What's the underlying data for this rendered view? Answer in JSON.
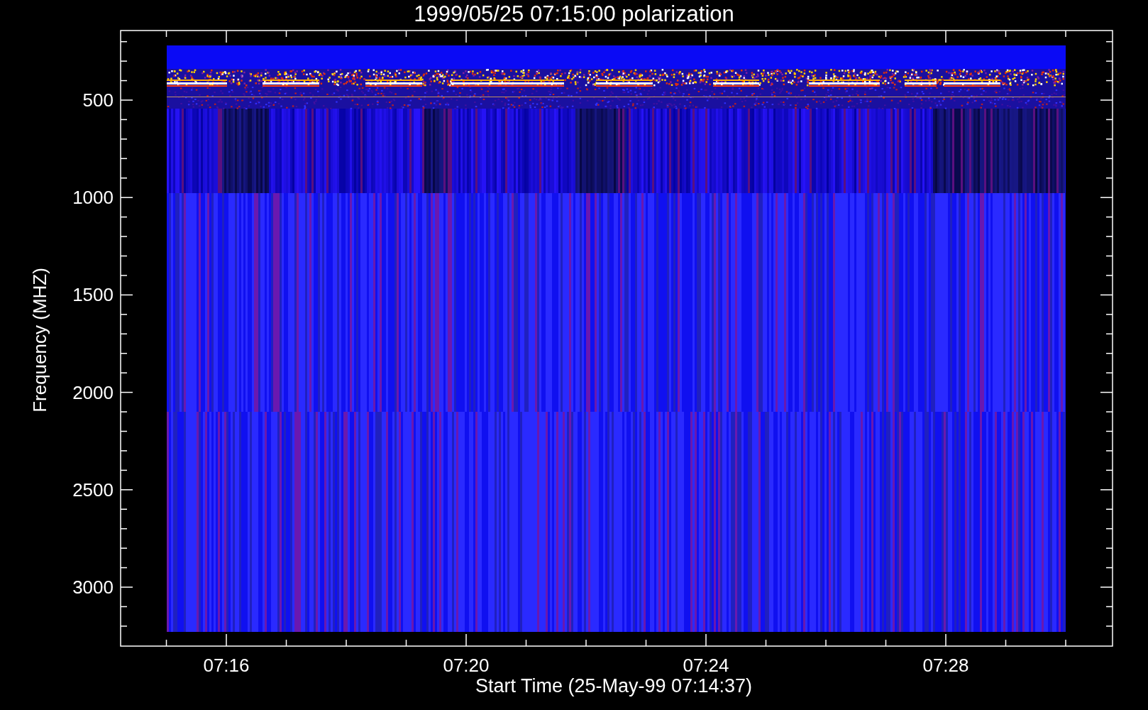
{
  "title": "1999/05/25 07:15:00 polarization",
  "y_axis": {
    "label": "Frequency (MHZ)",
    "ticks": [
      "500",
      "1000",
      "1500",
      "2000",
      "2500",
      "3000"
    ]
  },
  "x_axis": {
    "label": "Start Time (25-May-99 07:14:37)",
    "ticks": [
      "07:16",
      "07:20",
      "07:24",
      "07:28"
    ]
  }
}
